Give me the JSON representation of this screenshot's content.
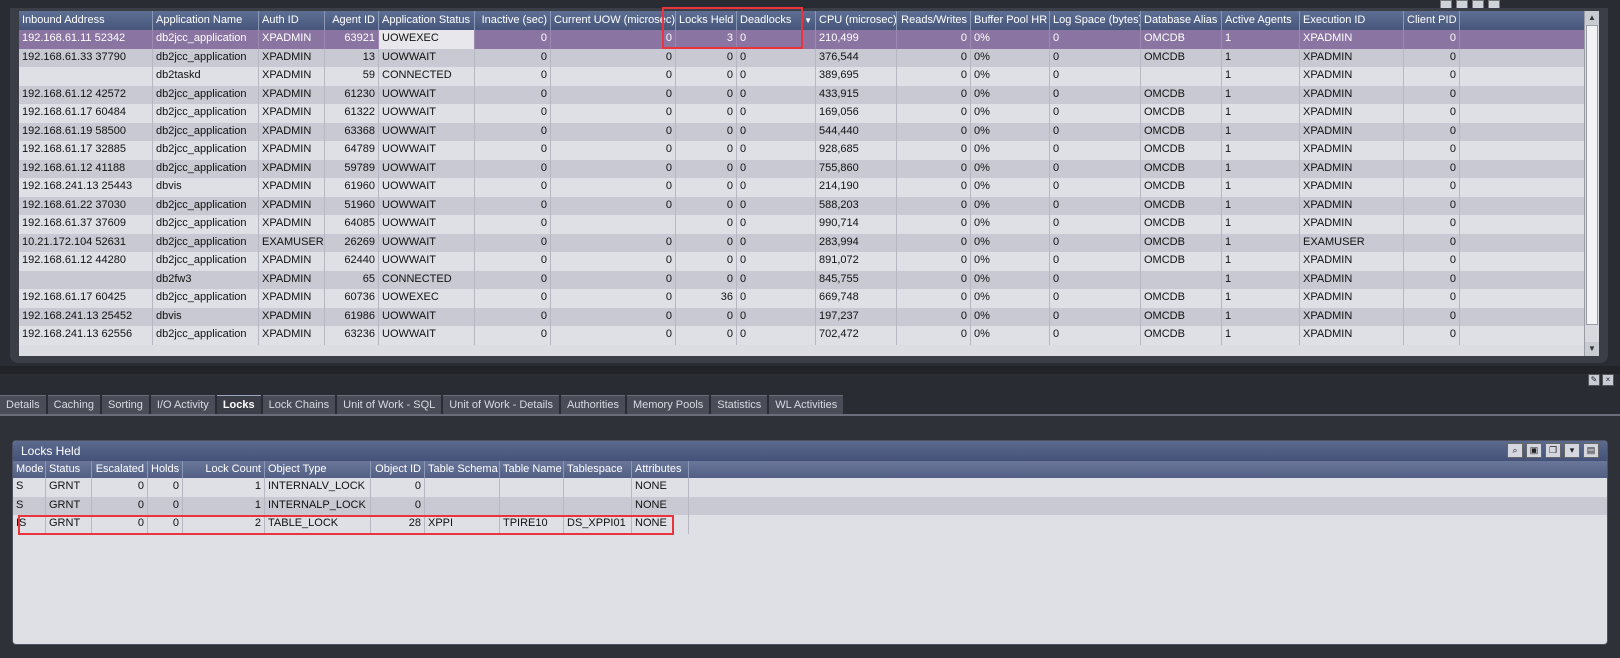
{
  "upper_grid": {
    "columns": [
      {
        "label": "Inbound Address",
        "w": 134,
        "align": "left"
      },
      {
        "label": "Application Name",
        "w": 106,
        "align": "left"
      },
      {
        "label": "Auth ID",
        "w": 66,
        "align": "left"
      },
      {
        "label": "Agent ID",
        "w": 54,
        "align": "right"
      },
      {
        "label": "Application Status",
        "w": 96,
        "align": "left"
      },
      {
        "label": "Inactive (sec)",
        "w": 76,
        "align": "right"
      },
      {
        "label": "Current UOW (microsec)",
        "w": 125,
        "align": "right"
      },
      {
        "label": "Locks Held",
        "w": 61,
        "align": "right"
      },
      {
        "label": "Deadlocks",
        "w": 79,
        "align": "left",
        "sorted": true
      },
      {
        "label": "CPU (microsec)",
        "w": 81,
        "align": "left"
      },
      {
        "label": "Reads/Writes",
        "w": 74,
        "align": "right"
      },
      {
        "label": "Buffer Pool HR",
        "w": 79,
        "align": "left"
      },
      {
        "label": "Log Space (bytes)",
        "w": 91,
        "align": "left"
      },
      {
        "label": "Database Alias",
        "w": 81,
        "align": "left"
      },
      {
        "label": "Active Agents",
        "w": 78,
        "align": "left"
      },
      {
        "label": "Execution ID",
        "w": 104,
        "align": "left"
      },
      {
        "label": "Client PID",
        "w": 56,
        "align": "right"
      }
    ],
    "rows": [
      [
        "192.168.61.11 52342",
        "db2jcc_application",
        "XPADMIN",
        "63921",
        "UOWEXEC",
        "0",
        "0",
        "3",
        "0",
        "210,499",
        "0",
        "0%",
        "0",
        "OMCDB",
        "1",
        "XPADMIN",
        "0"
      ],
      [
        "192.168.61.33 37790",
        "db2jcc_application",
        "XPADMIN",
        "13",
        "UOWWAIT",
        "0",
        "0",
        "0",
        "0",
        "376,544",
        "0",
        "0%",
        "0",
        "OMCDB",
        "1",
        "XPADMIN",
        "0"
      ],
      [
        "",
        "db2taskd",
        "XPADMIN",
        "59",
        "CONNECTED",
        "0",
        "0",
        "0",
        "0",
        "389,695",
        "0",
        "0%",
        "0",
        "",
        "1",
        "XPADMIN",
        "0"
      ],
      [
        "192.168.61.12 42572",
        "db2jcc_application",
        "XPADMIN",
        "61230",
        "UOWWAIT",
        "0",
        "0",
        "0",
        "0",
        "433,915",
        "0",
        "0%",
        "0",
        "OMCDB",
        "1",
        "XPADMIN",
        "0"
      ],
      [
        "192.168.61.17 60484",
        "db2jcc_application",
        "XPADMIN",
        "61322",
        "UOWWAIT",
        "0",
        "0",
        "0",
        "0",
        "169,056",
        "0",
        "0%",
        "0",
        "OMCDB",
        "1",
        "XPADMIN",
        "0"
      ],
      [
        "192.168.61.19 58500",
        "db2jcc_application",
        "XPADMIN",
        "63368",
        "UOWWAIT",
        "0",
        "0",
        "0",
        "0",
        "544,440",
        "0",
        "0%",
        "0",
        "OMCDB",
        "1",
        "XPADMIN",
        "0"
      ],
      [
        "192.168.61.17 32885",
        "db2jcc_application",
        "XPADMIN",
        "64789",
        "UOWWAIT",
        "0",
        "0",
        "0",
        "0",
        "928,685",
        "0",
        "0%",
        "0",
        "OMCDB",
        "1",
        "XPADMIN",
        "0"
      ],
      [
        "192.168.61.12 41188",
        "db2jcc_application",
        "XPADMIN",
        "59789",
        "UOWWAIT",
        "0",
        "0",
        "0",
        "0",
        "755,860",
        "0",
        "0%",
        "0",
        "OMCDB",
        "1",
        "XPADMIN",
        "0"
      ],
      [
        "192.168.241.13 25443",
        "dbvis",
        "XPADMIN",
        "61960",
        "UOWWAIT",
        "0",
        "0",
        "0",
        "0",
        "214,190",
        "0",
        "0%",
        "0",
        "OMCDB",
        "1",
        "XPADMIN",
        "0"
      ],
      [
        "192.168.61.22 37030",
        "db2jcc_application",
        "XPADMIN",
        "51960",
        "UOWWAIT",
        "0",
        "0",
        "0",
        "0",
        "588,203",
        "0",
        "0%",
        "0",
        "OMCDB",
        "1",
        "XPADMIN",
        "0"
      ],
      [
        "192.168.61.37 37609",
        "db2jcc_application",
        "XPADMIN",
        "64085",
        "UOWWAIT",
        "0",
        "",
        "0",
        "0",
        "990,714",
        "0",
        "0%",
        "0",
        "OMCDB",
        "1",
        "XPADMIN",
        "0"
      ],
      [
        "10.21.172.104 52631",
        "db2jcc_application",
        "EXAMUSER",
        "26269",
        "UOWWAIT",
        "0",
        "0",
        "0",
        "0",
        "283,994",
        "0",
        "0%",
        "0",
        "OMCDB",
        "1",
        "EXAMUSER",
        "0"
      ],
      [
        "192.168.61.12 44280",
        "db2jcc_application",
        "XPADMIN",
        "62440",
        "UOWWAIT",
        "0",
        "0",
        "0",
        "0",
        "891,072",
        "0",
        "0%",
        "0",
        "OMCDB",
        "1",
        "XPADMIN",
        "0"
      ],
      [
        "",
        "db2fw3",
        "XPADMIN",
        "65",
        "CONNECTED",
        "0",
        "0",
        "0",
        "0",
        "845,755",
        "0",
        "0%",
        "0",
        "",
        "1",
        "XPADMIN",
        "0"
      ],
      [
        "192.168.61.17 60425",
        "db2jcc_application",
        "XPADMIN",
        "60736",
        "UOWEXEC",
        "0",
        "0",
        "36",
        "0",
        "669,748",
        "0",
        "0%",
        "0",
        "OMCDB",
        "1",
        "XPADMIN",
        "0"
      ],
      [
        "192.168.241.13 25452",
        "dbvis",
        "XPADMIN",
        "61986",
        "UOWWAIT",
        "0",
        "0",
        "0",
        "0",
        "197,237",
        "0",
        "0%",
        "0",
        "OMCDB",
        "1",
        "XPADMIN",
        "0"
      ],
      [
        "192.168.241.13 62556",
        "db2jcc_application",
        "XPADMIN",
        "63236",
        "UOWWAIT",
        "0",
        "0",
        "0",
        "0",
        "702,472",
        "0",
        "0%",
        "0",
        "OMCDB",
        "1",
        "XPADMIN",
        "0"
      ]
    ]
  },
  "tabs": [
    "Details",
    "Caching",
    "Sorting",
    "I/O Activity",
    "Locks",
    "Lock Chains",
    "Unit of Work - SQL",
    "Unit of Work - Details",
    "Authorities",
    "Memory Pools",
    "Statistics",
    "WL Activities"
  ],
  "active_tab": "Locks",
  "locks_panel": {
    "title": "Locks Held",
    "columns": [
      {
        "label": "Mode",
        "w": 33,
        "align": "left"
      },
      {
        "label": "Status",
        "w": 46,
        "align": "left"
      },
      {
        "label": "Escalated",
        "w": 56,
        "align": "right"
      },
      {
        "label": "Holds",
        "w": 35,
        "align": "right"
      },
      {
        "label": "Lock Count",
        "w": 82,
        "align": "right"
      },
      {
        "label": "Object Type",
        "w": 106,
        "align": "left"
      },
      {
        "label": "Object ID",
        "w": 54,
        "align": "right"
      },
      {
        "label": "Table Schema",
        "w": 75,
        "align": "left"
      },
      {
        "label": "Table Name",
        "w": 64,
        "align": "left"
      },
      {
        "label": "Tablespace",
        "w": 68,
        "align": "left"
      },
      {
        "label": "Attributes",
        "w": 57,
        "align": "left"
      }
    ],
    "rows": [
      [
        "S",
        "GRNT",
        "0",
        "0",
        "1",
        "INTERNALV_LOCK",
        "0",
        "",
        "",
        "",
        "NONE"
      ],
      [
        "S",
        "GRNT",
        "0",
        "0",
        "1",
        "INTERNALP_LOCK",
        "0",
        "",
        "",
        "",
        "NONE"
      ],
      [
        "IS",
        "GRNT",
        "0",
        "0",
        "2",
        "TABLE_LOCK",
        "28",
        "XPPI",
        "TPIRE10",
        "DS_XPPI01",
        "NONE"
      ]
    ]
  },
  "colors": {
    "header": "#4f5e84",
    "selected_row": "#8a74a1",
    "highlight": "#e8343a"
  }
}
